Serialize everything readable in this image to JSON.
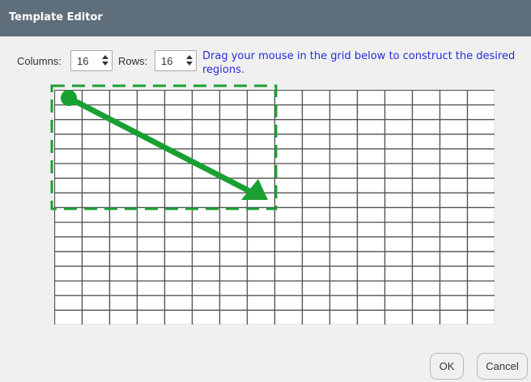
{
  "window": {
    "title": "Template Editor"
  },
  "controls": {
    "columns_label": "Columns:",
    "columns_value": "16",
    "rows_label": "Rows:",
    "rows_value": "16",
    "hint": "Drag your mouse in the grid below to construct the desired regions."
  },
  "grid": {
    "columns": 16,
    "rows": 16,
    "selected_columns": 8,
    "selected_rows": 8
  },
  "buttons": {
    "ok": "OK",
    "cancel": "Cancel"
  },
  "colors": {
    "titlebar": "#5f6e7b",
    "hint_text": "#2b2bd6",
    "annotation": "#1aa032",
    "grid_line": "#555555"
  }
}
